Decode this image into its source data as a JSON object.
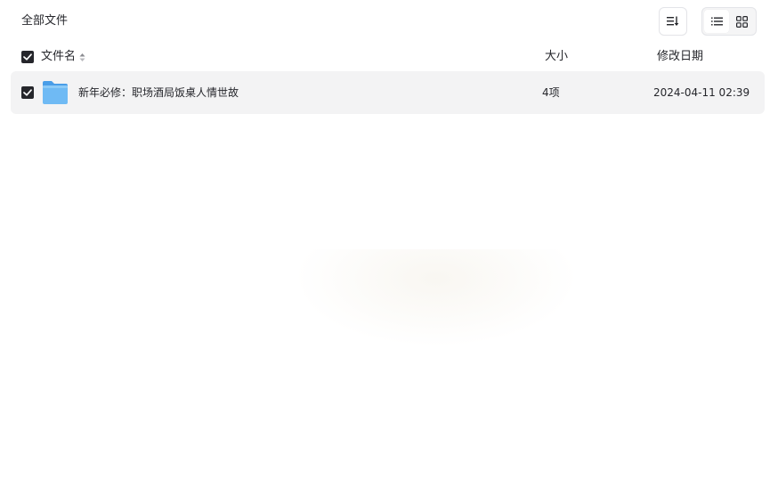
{
  "breadcrumb": {
    "title": "全部文件"
  },
  "toolbar": {
    "sort_icon": "sort-icon",
    "list_view_icon": "list-view-icon",
    "grid_view_icon": "grid-view-icon",
    "active_view": "list"
  },
  "table": {
    "headers": {
      "name": "文件名",
      "size": "大小",
      "date": "修改日期"
    },
    "rows": [
      {
        "name": "新年必修：职场酒局饭桌人情世故",
        "size": "4项",
        "date": "2024-04-11 02:39",
        "type": "folder",
        "checked": true
      }
    ]
  },
  "colors": {
    "checkbox": "#25262b",
    "row_bg": "#f3f3f4",
    "folder": "#5fb2f3"
  }
}
